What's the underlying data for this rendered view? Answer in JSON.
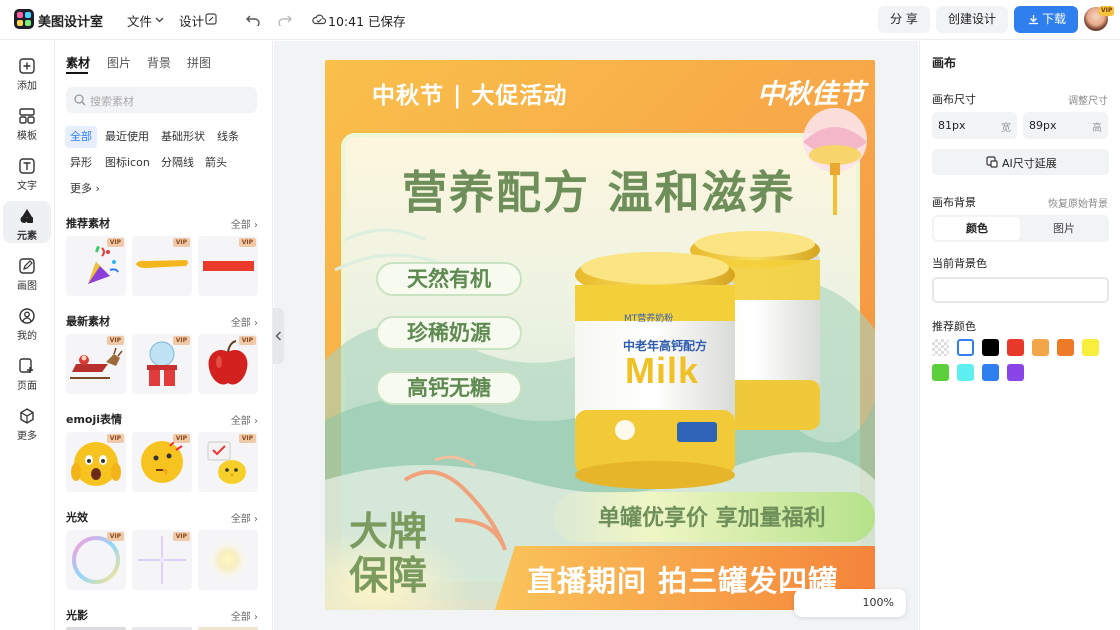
{
  "app": {
    "name": "美图设计室"
  },
  "topbar": {
    "file_menu": "文件",
    "design_menu": "设计",
    "save_status": "10:41 已保存",
    "share_button": "分 享",
    "create_button": "创建设计",
    "download_button": "下载",
    "avatar_badge": "VIP"
  },
  "leftnav": {
    "items": [
      {
        "label": "添加",
        "icon": "plus-square-icon"
      },
      {
        "label": "模板",
        "icon": "template-icon"
      },
      {
        "label": "文字",
        "icon": "text-icon"
      },
      {
        "label": "元素",
        "icon": "shapes-icon"
      },
      {
        "label": "画图",
        "icon": "pen-icon"
      },
      {
        "label": "我的",
        "icon": "user-icon"
      },
      {
        "label": "页面",
        "icon": "page-add-icon"
      },
      {
        "label": "更多",
        "icon": "cube-icon"
      }
    ],
    "active": "元素"
  },
  "assets": {
    "tabs": [
      "素材",
      "图片",
      "背景",
      "拼图"
    ],
    "active_tab": "素材",
    "search_placeholder": "搜索素材",
    "chips": [
      "全部",
      "最近使用",
      "基础形状",
      "线条",
      "异形",
      "图标icon",
      "分隔线",
      "箭头",
      "更多"
    ],
    "active_chip": "全部",
    "all_label": "全部",
    "vip_label": "VIP",
    "sections": [
      {
        "title": "推荐素材",
        "items": [
          "party-popper",
          "yellow-brush-stroke",
          "red-bar"
        ]
      },
      {
        "title": "最新素材",
        "items": [
          "santa-sleigh",
          "snow-globe-gift",
          "red-apple"
        ]
      },
      {
        "title": "emoji表情",
        "items": [
          "screaming-face",
          "thinking-face",
          "chick-with-sign"
        ]
      },
      {
        "title": "光效",
        "items": [
          "bubble-ring",
          "star-sparkle",
          "glow-dot"
        ]
      },
      {
        "title": "光影",
        "items": []
      }
    ]
  },
  "poster": {
    "header": "中秋节 | 大促活动",
    "calligraphy": "中秋佳节",
    "headline": "营养配方 温和滋养",
    "features": [
      "天然有机",
      "珍稀奶源",
      "高钙无糖"
    ],
    "product_brand": "MT营养奶粉",
    "product_subtitle": "中老年高钙配方",
    "product_name": "Milk",
    "guarantee": "大牌\n保障",
    "offer": "单罐优享价 享加量福利",
    "bottom_banner": "直播期间 拍三罐发四罐"
  },
  "zoom": "100%",
  "rightpanel": {
    "title": "画布",
    "size_label": "画布尺寸",
    "size_hint": "调整尺寸",
    "width_value": "81px",
    "width_unit": "宽",
    "height_value": "89px",
    "height_unit": "高",
    "ai_button": "AI尺寸延展",
    "bg_label": "画布背景",
    "bg_hint": "恢复原始背景",
    "bg_tabs": [
      "颜色",
      "图片"
    ],
    "bg_active_tab": "颜色",
    "current_bg_label": "当前背景色",
    "recommend_label": "推荐颜色",
    "swatches": [
      "transparent",
      "#ffffff",
      "#000000",
      "#e8392b",
      "#f3a54a",
      "#ec7a26",
      "#f7ef3b",
      "#5ccf3d",
      "#5ef0f0",
      "#2f7fef",
      "#8a45e9"
    ]
  }
}
